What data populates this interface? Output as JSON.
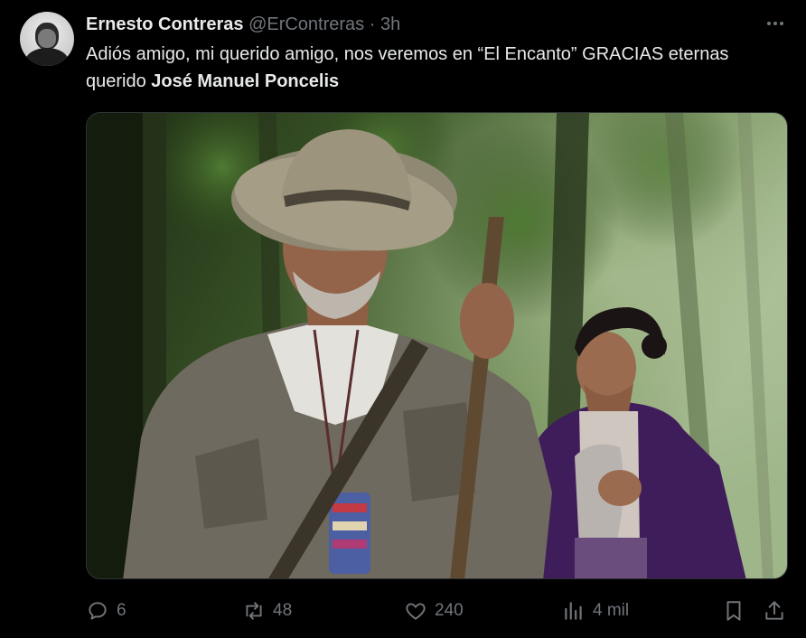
{
  "tweet": {
    "author_name": "Ernesto Contreras",
    "author_handle": "@ErContreras",
    "separator": "·",
    "time": "3h",
    "text_plain": "Adiós amigo, mi querido amigo, nos veremos en “El Encanto” GRACIAS eternas querido ",
    "text_bold": "José Manuel Poncelis"
  },
  "actions": {
    "replies": "6",
    "reposts": "48",
    "likes": "240",
    "views": "4 mil"
  },
  "icons": {
    "more": "more-icon",
    "reply": "reply-icon",
    "repost": "repost-icon",
    "like": "heart-icon",
    "views": "views-icon",
    "bookmark": "bookmark-icon",
    "share": "share-icon"
  },
  "colors": {
    "background": "#000000",
    "text": "#e7e9ea",
    "muted": "#71767b"
  }
}
